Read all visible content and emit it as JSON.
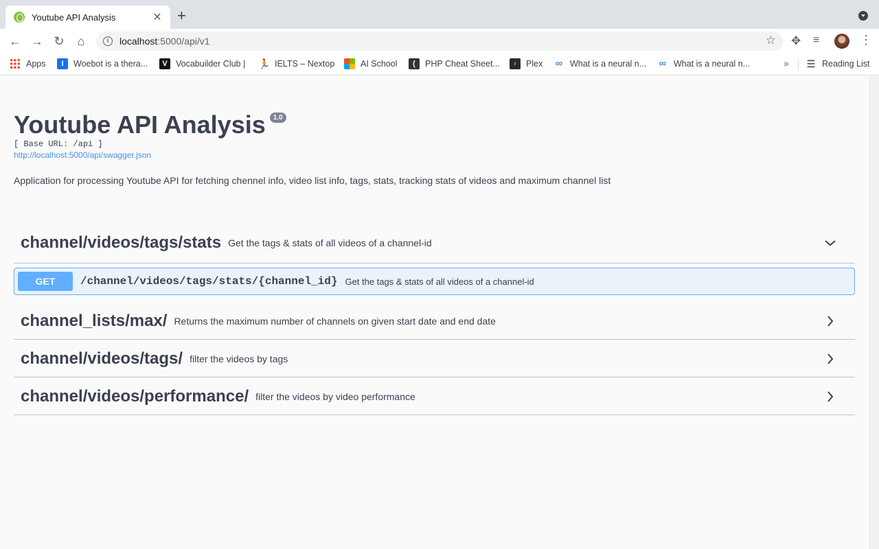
{
  "browser": {
    "tab_title": "Youtube API Analysis",
    "url_host": "localhost",
    "url_path": ":5000/api/v1",
    "bookmarks": [
      {
        "label": "Apps",
        "icon": "apps-grid-icon"
      },
      {
        "label": "Woebot is a thera...",
        "icon": "woebot-icon"
      },
      {
        "label": "Vocabuilder Club |",
        "icon": "vocabuilder-icon"
      },
      {
        "label": "IELTS – Nextop",
        "icon": "runner-icon"
      },
      {
        "label": "AI School",
        "icon": "microsoft-icon"
      },
      {
        "label": "PHP Cheat Sheet...",
        "icon": "php-icon"
      },
      {
        "label": "Plex",
        "icon": "plex-icon"
      },
      {
        "label": "What is a neural n...",
        "icon": "infinity-icon"
      },
      {
        "label": "What is a neural n...",
        "icon": "infinity-icon"
      }
    ],
    "reading_list": "Reading List"
  },
  "info": {
    "title": "Youtube API Analysis",
    "version": "1.0",
    "base_url": "[ Base URL: /api ]",
    "spec_link": "http://localhost:5000/api/swagger.json",
    "description": "Application for processing Youtube API for fetching chennel info, video list info, tags, stats, tracking stats of videos and maximum channel list"
  },
  "sections": [
    {
      "name": "channel/videos/tags/stats",
      "description": "Get the tags & stats of all videos of a channel-id",
      "expanded": true
    },
    {
      "name": "channel_lists/max/",
      "description": "Returns the maximum number of channels on given start date and end date",
      "expanded": false
    },
    {
      "name": "channel/videos/tags/",
      "description": "filter the videos by tags",
      "expanded": false
    },
    {
      "name": "channel/videos/performance/",
      "description": "filter the videos by video performance",
      "expanded": false
    }
  ],
  "operation": {
    "method": "GET",
    "path": "/channel/videos/tags/stats/{channel_id}",
    "summary": "Get the tags & stats of all videos of a channel-id"
  },
  "colors": {
    "get": "#61affe",
    "text": "#3b4151",
    "link": "#4990e2"
  }
}
